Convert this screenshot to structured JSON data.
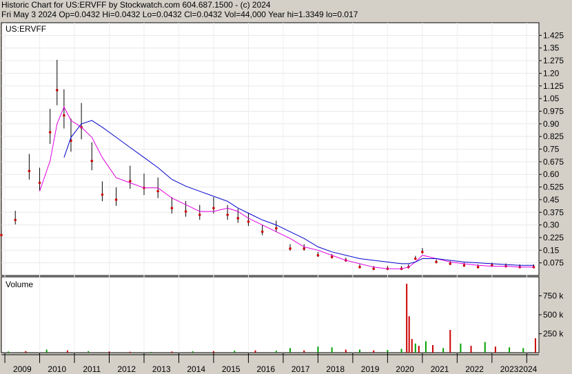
{
  "header": {
    "line1": "Historic Chart for US:ERVFF by Stockwatch.com 604.687.1500 - (c) 2024",
    "line2": "Fri May  3 2024   Op=0.0432   Hi=0.0432   Lo=0.0432   Cl=0.0432   Vol=44,000   Year hi=1.3349   lo=0.017"
  },
  "chart_data": [
    {
      "type": "line",
      "title": "US:ERVFF",
      "ylim": [
        0,
        1.5
      ],
      "y_ticks": [
        "1.425",
        "1.35",
        "1.275",
        "1.20",
        "1.125",
        "1.05",
        "0.975",
        "0.90",
        "0.825",
        "0.75",
        "0.675",
        "0.60",
        "0.525",
        "0.45",
        "0.375",
        "0.30",
        "0.225",
        "0.15",
        "0.075"
      ],
      "x_ticks": [
        "2009",
        "2010",
        "2011",
        "2012",
        "2013",
        "2014",
        "2015",
        "2016",
        "2017",
        "2018",
        "2019",
        "2020",
        "2021",
        "2022",
        "2023",
        "2024"
      ],
      "colors": {
        "price": "#cc0000",
        "range": "#000000",
        "ma_short": "#e000e0",
        "ma_long": "#0000cc",
        "grid": "#ffffff",
        "plot_bg": "#ffffff"
      },
      "x": [
        2008.9,
        2009.3,
        2009.7,
        2010.0,
        2010.3,
        2010.5,
        2010.7,
        2010.9,
        2011.2,
        2011.5,
        2011.8,
        2012.2,
        2012.6,
        2013.0,
        2013.4,
        2013.8,
        2014.2,
        2014.6,
        2015.0,
        2015.4,
        2015.7,
        2016.0,
        2016.4,
        2016.8,
        2017.2,
        2017.6,
        2018.0,
        2018.4,
        2018.8,
        2019.2,
        2019.6,
        2020.0,
        2020.4,
        2020.6,
        2020.8,
        2021.0,
        2021.4,
        2021.8,
        2022.2,
        2022.6,
        2023.0,
        2023.4,
        2023.8,
        2024.2
      ],
      "series": [
        {
          "name": "price",
          "values": [
            0.24,
            0.33,
            0.62,
            0.55,
            0.85,
            1.1,
            0.95,
            0.8,
            0.88,
            0.68,
            0.48,
            0.45,
            0.56,
            0.52,
            0.5,
            0.4,
            0.38,
            0.36,
            0.4,
            0.36,
            0.34,
            0.32,
            0.26,
            0.28,
            0.16,
            0.16,
            0.12,
            0.11,
            0.09,
            0.05,
            0.04,
            0.04,
            0.04,
            0.05,
            0.1,
            0.14,
            0.08,
            0.07,
            0.06,
            0.05,
            0.06,
            0.055,
            0.05,
            0.05
          ]
        },
        {
          "name": "ma_short",
          "values": [
            null,
            null,
            null,
            0.5,
            0.68,
            0.9,
            1.0,
            0.92,
            0.88,
            0.82,
            0.7,
            0.58,
            0.55,
            0.52,
            0.52,
            0.46,
            0.42,
            0.38,
            0.38,
            0.4,
            0.38,
            0.34,
            0.3,
            0.26,
            0.22,
            0.17,
            0.15,
            0.12,
            0.09,
            0.07,
            0.05,
            0.04,
            0.04,
            0.05,
            0.08,
            0.12,
            0.1,
            0.08,
            0.07,
            0.06,
            0.055,
            0.055,
            0.05,
            0.05
          ]
        },
        {
          "name": "ma_long",
          "values": [
            null,
            null,
            null,
            null,
            null,
            null,
            0.7,
            0.82,
            0.9,
            0.92,
            0.88,
            0.82,
            0.76,
            0.7,
            0.64,
            0.57,
            0.53,
            0.5,
            0.47,
            0.44,
            0.4,
            0.37,
            0.33,
            0.3,
            0.26,
            0.22,
            0.17,
            0.14,
            0.12,
            0.1,
            0.09,
            0.08,
            0.07,
            0.07,
            0.08,
            0.1,
            0.1,
            0.09,
            0.08,
            0.075,
            0.07,
            0.065,
            0.06,
            0.06
          ]
        }
      ]
    },
    {
      "type": "bar",
      "title": "Volume",
      "ylim": [
        0,
        1000000
      ],
      "y_ticks": [
        "750 k",
        "500 k",
        "250 k"
      ],
      "colors": {
        "up": "#00a000",
        "down": "#cc0000"
      },
      "x": [
        2009.1,
        2009.6,
        2010.2,
        2010.8,
        2011.4,
        2012.0,
        2012.6,
        2013.2,
        2013.8,
        2014.4,
        2015.0,
        2015.6,
        2016.2,
        2016.8,
        2017.2,
        2017.6,
        2018.0,
        2018.4,
        2018.8,
        2019.2,
        2019.6,
        2020.0,
        2020.4,
        2020.55,
        2020.62,
        2020.7,
        2020.8,
        2020.9,
        2021.1,
        2021.3,
        2021.6,
        2021.8,
        2022.1,
        2022.4,
        2022.8,
        2023.1,
        2023.5,
        2023.9,
        2024.25
      ],
      "values": [
        15000,
        20000,
        40000,
        30000,
        20000,
        15000,
        12000,
        10000,
        15000,
        18000,
        20000,
        25000,
        30000,
        25000,
        60000,
        30000,
        80000,
        70000,
        40000,
        40000,
        30000,
        35000,
        50000,
        910000,
        480000,
        180000,
        120000,
        90000,
        150000,
        100000,
        60000,
        300000,
        120000,
        90000,
        140000,
        80000,
        70000,
        60000,
        190000
      ],
      "direction": [
        "u",
        "d",
        "u",
        "d",
        "u",
        "d",
        "d",
        "u",
        "d",
        "u",
        "d",
        "u",
        "d",
        "u",
        "u",
        "d",
        "u",
        "u",
        "d",
        "u",
        "d",
        "u",
        "u",
        "d",
        "d",
        "d",
        "u",
        "d",
        "u",
        "d",
        "u",
        "d",
        "u",
        "d",
        "u",
        "d",
        "u",
        "u",
        "d"
      ]
    }
  ]
}
